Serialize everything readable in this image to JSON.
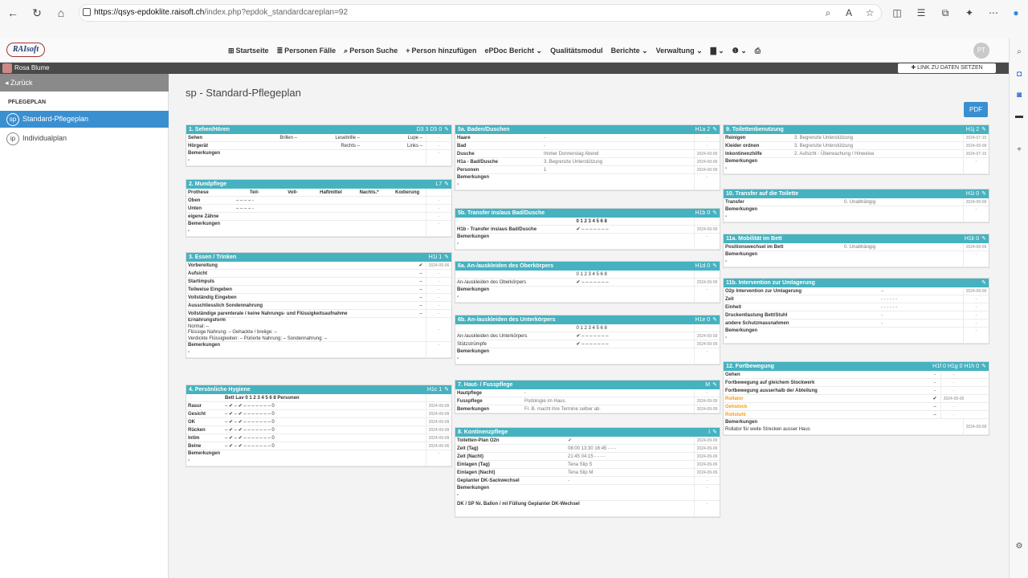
{
  "browser": {
    "url_host": "https://qsys-epdoklite.raisoft.ch",
    "url_path": "/index.php?epdok_standardcareplan=92"
  },
  "app": {
    "logo": "RAIsoft",
    "menu": [
      {
        "icon": "⊞",
        "label": "Startseite"
      },
      {
        "icon": "≣",
        "label": "Personen Fälle"
      },
      {
        "icon": "⌕",
        "label": "Person Suche"
      },
      {
        "icon": "+",
        "label": "Person hinzufügen"
      },
      {
        "icon": "",
        "label": "ePDoc Bericht ⌄"
      },
      {
        "icon": "",
        "label": "Qualitätsmodul"
      },
      {
        "icon": "",
        "label": "Berichte ⌄"
      },
      {
        "icon": "",
        "label": "Verwaltung ⌄"
      },
      {
        "icon": "",
        "label": "▇ ⌄"
      },
      {
        "icon": "",
        "label": "❶ ⌄"
      },
      {
        "icon": "",
        "label": "⎙"
      }
    ],
    "avatar": "PT"
  },
  "patient": {
    "name": "Rosa Blume",
    "link_button": "✚ LINK ZU DATEN SETZEN"
  },
  "sidebar": {
    "back": "◂ Zurück",
    "heading": "PFLEGEPLAN",
    "items": [
      {
        "badge": "sp",
        "label": "Standard-Pflegeplan"
      },
      {
        "badge": "ip",
        "label": "Individualplan"
      }
    ]
  },
  "main": {
    "title": "sp - Standard-Pflegeplan",
    "pdf": "PDF"
  },
  "cards": {
    "c1": {
      "title": "1. Sehen/Hören",
      "codes": "D3  3  D5  0",
      "r1": {
        "a": "Sehen",
        "b": "Brillen  –",
        "c": "Lesebrille  –",
        "d": "Lupe  –",
        "e": "-"
      },
      "r2": {
        "a": "Hörgerät",
        "b": "",
        "c": "Rechts  –",
        "d": "Links  –",
        "e": "-"
      },
      "r3": "Bemerkungen",
      "r3d": "-",
      "dash": "-"
    },
    "c2": {
      "title": "2. Mundpflege",
      "codes": "L7",
      "head": [
        "Prothese",
        "Teil-",
        "Voll-",
        "Haftmittel",
        "Nachts.*",
        "Kodierung"
      ],
      "rows": [
        {
          "l": "Oben",
          "v": "–   –   –   –   -",
          "d": "-"
        },
        {
          "l": "Unten",
          "v": "–   –   –   –   -",
          "d": "-"
        },
        {
          "l": "eigene Zähne",
          "v": "",
          "d": "-"
        }
      ],
      "bem": "Bemerkungen",
      "bemd": "-",
      "dash": "-"
    },
    "c3": {
      "title": "3. Essen / Trinken",
      "codes": "H1i  1",
      "rows": [
        {
          "l": "Vorbereitung",
          "m": "✔",
          "d": "2024-09-06"
        },
        {
          "l": "Aufsicht",
          "m": "–",
          "d": "-"
        },
        {
          "l": "Startimpuls",
          "m": "–",
          "d": "-"
        },
        {
          "l": "Teilweise Eingeben",
          "m": "–",
          "d": "-"
        },
        {
          "l": "Vollständig Eingeben",
          "m": "–",
          "d": "-"
        },
        {
          "l": "Ausschliesslich Sondennahrung",
          "m": "–",
          "d": "-"
        },
        {
          "l": "Vollständige parenterale / keine Nahrungs- und Flüssigkeitsaufnahme",
          "m": "–",
          "d": "-"
        }
      ],
      "ern": "Ernährungsform",
      "ern2": "Normal: –",
      "ern3": "Flüssige Nahrung: –   Gehackte / breiige: –",
      "ern4": "Verdickte Flüssigkeiten: –   Pürierte Nahrung: –   Sondennahrung: –",
      "bem": "Bemerkungen",
      "bemd": "-",
      "dash": "-"
    },
    "c4": {
      "title": "4. Persönliche Hygiene",
      "codes": "H1c  1",
      "head": "Bett  Lav   0    1    2    3    4    5    6    8   Personen",
      "rows": [
        {
          "l": "Rasur",
          "v": "–   ✔   –  ✔   –   –   –   –   –   –     –     0",
          "d": "2024-09-09"
        },
        {
          "l": "Gesicht",
          "v": "–   ✔   –  ✔   –   –   –   –   –   –     –     0",
          "d": "2024-09-09"
        },
        {
          "l": "OK",
          "v": "–   ✔   –  ✔   –   –   –   –   –   –     –     0",
          "d": "2024-09-09"
        },
        {
          "l": "Rücken",
          "v": "–   ✔   –  ✔   –   –   –   –   –   –     –     0",
          "d": "2024-09-09"
        },
        {
          "l": "Intim",
          "v": "–   ✔   –  ✔   –   –   –   –   –   –     –     0",
          "d": "2024-09-09"
        },
        {
          "l": "Beine",
          "v": "–   ✔   –  ✔   –   –   –   –   –   –     –     0",
          "d": "2024-09-06"
        }
      ],
      "bem": "Bemerkungen",
      "bemd": "-",
      "dash": "-"
    },
    "c5a": {
      "title": "5a. Baden/Duschen",
      "codes": "H1a  2",
      "rows": [
        {
          "l": "Haare",
          "v": "-",
          "d": "-"
        },
        {
          "l": "Bad",
          "v": "-",
          "d": "-"
        },
        {
          "l": "Dusche",
          "v": "Immer Donnerstag Abend",
          "d": "2024-09-09"
        },
        {
          "l": "H1a - Bad/Dusche",
          "v": "3. Begrenzte Unterstützung",
          "d": "2024-09-09"
        },
        {
          "l": "Personen",
          "v": "1",
          "d": "2024-09-09"
        }
      ],
      "bem": "Bemerkungen",
      "bemd": "-",
      "dash": "-"
    },
    "c5b": {
      "title": "5b. Transfer ins/aus Bad/Dusche",
      "codes": "H1b  0",
      "head": "0     1     2     3     4     5     6     8",
      "r1": {
        "l": "H1b - Transfer ins/aus Bad/Dusche",
        "v": "✔     –     –     –     –     –     –     –",
        "d": "2024-09-09"
      },
      "bem": "Bemerkungen",
      "bemd": "-",
      "dash": "-"
    },
    "c6a": {
      "title": "6a. An-/auskleiden des Oberkörpers",
      "codes": "H1d  0",
      "head": "0     1     2     3     4     5     6     8",
      "r1": {
        "l": "An-/auskleiden des Oberkörpers",
        "v": "✔     –     –     –     –     –     –     –",
        "d": "2024-09-09"
      },
      "bem": "Bemerkungen",
      "bemd": "-",
      "dash": "-"
    },
    "c6b": {
      "title": "6b. An-/auskleiden des Unterkörpers",
      "codes": "H1e  0",
      "head": "0     1     2     3     4     5     6     8",
      "r1": {
        "l": "An-/auskleiden des Unterkörpers",
        "v": "✔     –     –     –     –     –     –     –",
        "d": "2024-09-09"
      },
      "r2": {
        "l": "Stützstrümpfe",
        "v": "✔     –     –     –     –     –     –     –",
        "d": "2024-09-09"
      },
      "bem": "Bemerkungen",
      "bemd": "-",
      "dash": "-"
    },
    "c7": {
      "title": "7. Haut- / Fusspflege",
      "codes": "M",
      "rows": [
        {
          "l": "Hautpflege",
          "v": "-",
          "d": "-"
        },
        {
          "l": "Fusspflege",
          "v": "Podologie im Haus.",
          "d": "2024-09-09"
        },
        {
          "l": "Bemerkungen",
          "v": "Fr. B. macht ihre Termine selber ab.",
          "d": "2024-09-09"
        }
      ]
    },
    "c8": {
      "title": "8. Kontinenzpflege",
      "codes": "I",
      "rows": [
        {
          "l": "Toiletten-Plan O2n",
          "v": "✔",
          "d": "2024-09-09"
        },
        {
          "l": "Zeit (Tag)",
          "v": "08:00       13:30       16:45       -    -    -",
          "d": "2024-09-09"
        },
        {
          "l": "Zeit (Nacht)",
          "v": "21:45       04:15       -             -    -    -",
          "d": "2024-09-09"
        },
        {
          "l": "Einlagen (Tag)",
          "v": "Tena Slip S",
          "d": "2024-09-09"
        },
        {
          "l": "Einlagen (Nacht)",
          "v": "Tena Slip M",
          "d": "2024-09-09"
        },
        {
          "l": "Geplanter DK-Sackwechsel",
          "v": "-",
          "d": "-"
        }
      ],
      "bem": "Bemerkungen",
      "bemd": "-",
      "dk": "DK / SP Nr.          Ballon / ml          Füllung          Geplanter DK-Wechsel",
      "dash": "-"
    },
    "c9": {
      "title": "9. Toilettenbenutzung",
      "codes": "H1j  2",
      "rows": [
        {
          "l": "Reinigen",
          "v": "3. Begrenzte Unterstützung",
          "d": "2024-07-15"
        },
        {
          "l": "Kleider ordnen",
          "v": "3. Begrenzte Unterstützung",
          "d": "2024-09-09"
        },
        {
          "l": "Inkontinenzhilfe",
          "v": "2. Aufsicht - Überwachung / Hinweise",
          "d": "2024-07-15"
        }
      ],
      "bem": "Bemerkungen",
      "bemd": "-",
      "dash": "-"
    },
    "c10": {
      "title": "10. Transfer auf die Toilette",
      "codes": "H1i  0",
      "r1": {
        "l": "Transfer",
        "v": "0. Unabhängig",
        "d": "2024-09-09"
      },
      "bem": "Bemerkungen",
      "bemd": "-",
      "dash": "-"
    },
    "c11a": {
      "title": "11a. Mobilität im Bett",
      "codes": "H1k  0",
      "r1": {
        "l": "Positionswechsel im Bett",
        "v": "0. Unabhängig",
        "d": "2024-09-09"
      },
      "bem": "Bemerkungen",
      "bemd": "-",
      "dash": "-"
    },
    "c11b": {
      "title": "11b. Intervention zur Umlagerung",
      "codes": "",
      "rows": [
        {
          "l": "O2p Intervention zur Umlagerung",
          "v": "–",
          "d": "2024-09-09"
        },
        {
          "l": "Zeit",
          "v": "-   -   -   -   -   -",
          "d": "-"
        },
        {
          "l": "Einheit",
          "v": "-   -   -   -   -   -",
          "d": "-"
        },
        {
          "l": "Druckentlastung Bett/Stuhl",
          "v": "-",
          "d": "-"
        },
        {
          "l": "andere Schutzmassnahmen",
          "v": "-",
          "d": "-"
        }
      ],
      "bem": "Bemerkungen",
      "bemd": "-",
      "dash": "-"
    },
    "c12": {
      "title": "12. Fortbewegung",
      "codes": "H1f  0  H1g  0  H1h  0",
      "rows": [
        {
          "l": "Gehen",
          "v": "-",
          "d": "-"
        },
        {
          "l": "Fortbewegung auf gleichem Stockwerk",
          "v": "-",
          "d": "-"
        },
        {
          "l": "Fortbewegung ausserhalb der Abteilung",
          "v": "-",
          "d": "-"
        },
        {
          "l": "Rollator",
          "v": "✔",
          "d": "2024-09-09"
        },
        {
          "l": "Gehstock",
          "v": "–",
          "d": "-"
        },
        {
          "l": "Rollstuhl",
          "v": "–",
          "d": "-"
        }
      ],
      "bem": "Bemerkungen",
      "bem2": "Rollator für weite Strecken ausser Haus",
      "bemd": "2024-09-09"
    }
  }
}
